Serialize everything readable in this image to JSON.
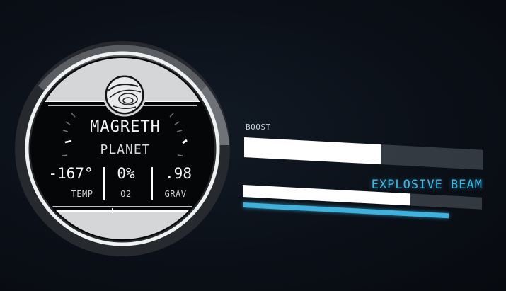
{
  "planet_scan": {
    "icon": "planet-globe-icon",
    "name": "MAGRETH",
    "type": "PLANET",
    "stats": [
      {
        "value": "-167°",
        "label": "TEMP"
      },
      {
        "value": "0%",
        "label": "O2"
      },
      {
        "value": ".98",
        "label": "GRAV"
      }
    ]
  },
  "ship": {
    "boost": {
      "label": "BOOST",
      "level": 0.57
    },
    "weapon": {
      "name": "EXPLOSIVE BEAM",
      "charge": 0.7,
      "energy": 1.0
    }
  },
  "colors": {
    "accent": "#3fb1dc",
    "hud_white": "#ffffff",
    "ring_gray": "#4a4d52",
    "background": "#0b0f16"
  }
}
